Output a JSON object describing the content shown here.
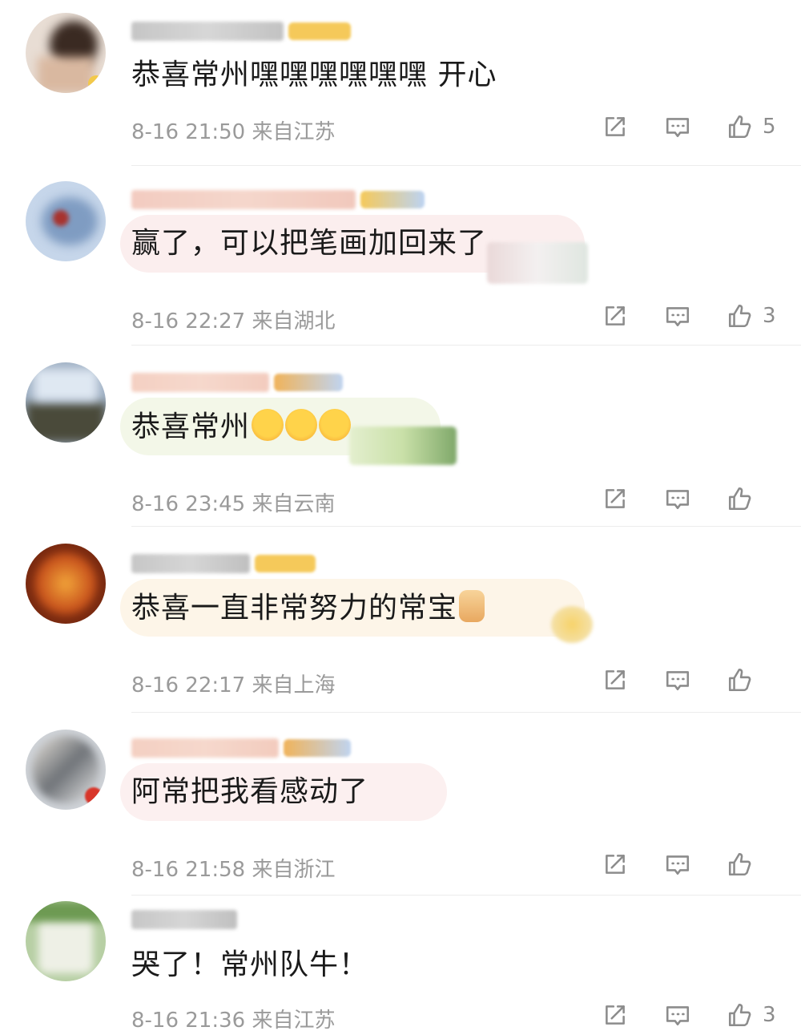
{
  "comments": [
    {
      "text": "恭喜常州嘿嘿嘿嘿嘿嘿 开心",
      "time": "8-16 21:50",
      "location": "来自江苏",
      "likes": "5"
    },
    {
      "text": "赢了，可以把笔画加回来了",
      "time": "8-16 22:27",
      "location": "来自湖北",
      "likes": "3"
    },
    {
      "text": "恭喜常州",
      "time": "8-16 23:45",
      "location": "来自云南",
      "likes": ""
    },
    {
      "text": "恭喜一直非常努力的常宝",
      "time": "8-16 22:17",
      "location": "来自上海",
      "likes": ""
    },
    {
      "text": "阿常把我看感动了",
      "time": "8-16 21:58",
      "location": "来自浙江",
      "likes": ""
    },
    {
      "text": "哭了！常州队牛！",
      "time": "8-16 21:36",
      "location": "来自江苏",
      "likes": "3"
    }
  ],
  "icons": {
    "share": "share-icon",
    "reply": "comment-icon",
    "like": "thumbs-up-icon"
  },
  "colors": {
    "text": "#1a1a1a",
    "meta": "#9a9a9a",
    "icon": "#8c8c8c",
    "divider": "#ececec"
  }
}
